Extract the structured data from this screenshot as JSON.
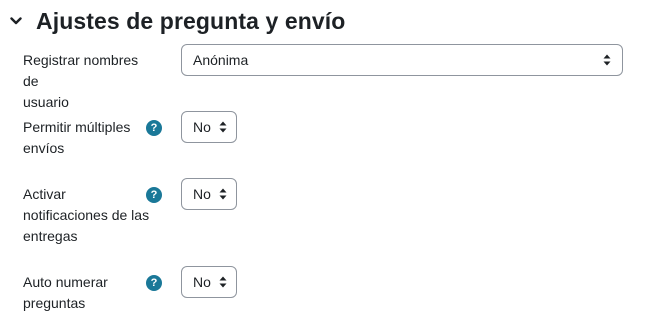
{
  "section": {
    "title": "Ajustes de pregunta y envío",
    "icon": "chevron-down-icon"
  },
  "fields": [
    {
      "label_lines": [
        "Registrar nombres de",
        "usuario"
      ],
      "value": "Anónima",
      "has_help": false
    },
    {
      "label_lines": [
        "Permitir múltiples",
        "envíos"
      ],
      "value": "No",
      "has_help": true
    },
    {
      "label_lines": [
        "Activar",
        "notificaciones de las",
        "entregas"
      ],
      "value": "No",
      "has_help": true
    },
    {
      "label_lines": [
        "Auto numerar",
        "preguntas"
      ],
      "value": "No",
      "has_help": true
    }
  ],
  "help_icon": {
    "glyph": "?",
    "color": "#1a7898"
  }
}
